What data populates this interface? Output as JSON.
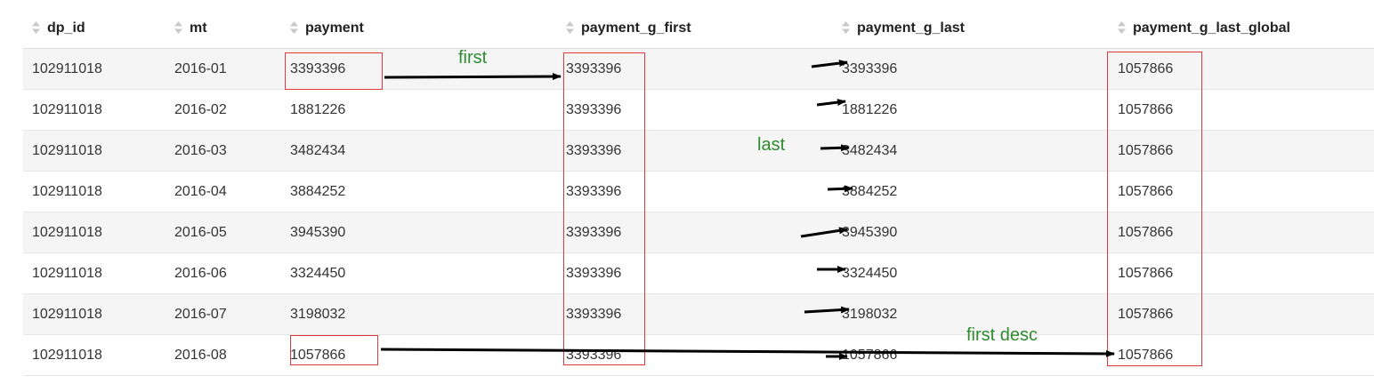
{
  "table": {
    "columns": [
      {
        "key": "dp_id",
        "label": "dp_id",
        "sort_icon": "sort-icon"
      },
      {
        "key": "mt",
        "label": "mt",
        "sort_icon": "sort-icon"
      },
      {
        "key": "payment",
        "label": "payment",
        "sort_icon": "sort-icon"
      },
      {
        "key": "payment_g_first",
        "label": "payment_g_first",
        "sort_icon": "sort-icon"
      },
      {
        "key": "payment_g_last",
        "label": "payment_g_last",
        "sort_icon": "sort-icon"
      },
      {
        "key": "payment_g_last_global",
        "label": "payment_g_last_global",
        "sort_icon": "sort-icon"
      }
    ],
    "rows": [
      [
        "102911018",
        "2016-01",
        "3393396",
        "3393396",
        "3393396",
        "1057866"
      ],
      [
        "102911018",
        "2016-02",
        "1881226",
        "3393396",
        "1881226",
        "1057866"
      ],
      [
        "102911018",
        "2016-03",
        "3482434",
        "3393396",
        "3482434",
        "1057866"
      ],
      [
        "102911018",
        "2016-04",
        "3884252",
        "3393396",
        "3884252",
        "1057866"
      ],
      [
        "102911018",
        "2016-05",
        "3945390",
        "3393396",
        "3945390",
        "1057866"
      ],
      [
        "102911018",
        "2016-06",
        "3324450",
        "3393396",
        "3324450",
        "1057866"
      ],
      [
        "102911018",
        "2016-07",
        "3198032",
        "3393396",
        "3198032",
        "1057866"
      ],
      [
        "102911018",
        "2016-08",
        "1057866",
        "3393396",
        "1057866",
        "1057866"
      ]
    ]
  },
  "annotations": {
    "first": "first",
    "last": "last",
    "first_desc": "first desc"
  },
  "colors": {
    "annotation_text": "#2e8b2e",
    "highlight_box": "#e0393a",
    "arrow": "#000000",
    "row_stripe": "#f5f5f5",
    "header_sort_icon": "#c8c8c8"
  }
}
